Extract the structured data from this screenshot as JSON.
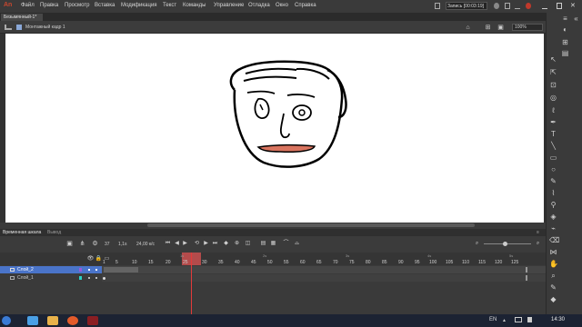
{
  "app": {
    "logo": "An"
  },
  "menu": [
    "Файл",
    "Правка",
    "Просмотр",
    "Вставка",
    "Модификация",
    "Текст",
    "Команды",
    "Управление",
    "Отладка",
    "Окно",
    "Справка"
  ],
  "recording": "Запись [00:03:19]",
  "doc_tab": "Безымянный-1*",
  "scene": {
    "label": "Монтажный кадр 1",
    "zoom": "100%"
  },
  "timeline": {
    "tabs": [
      "Временная шкала",
      "Вывод"
    ],
    "current_frame": "37",
    "fps": "24,00 к/с",
    "ruler_ticks": [
      "1",
      "5",
      "10",
      "15",
      "20",
      "25",
      "30",
      "35",
      "40",
      "45",
      "50",
      "55",
      "60",
      "65",
      "70",
      "75",
      "80",
      "85",
      "90",
      "95",
      "100",
      "105",
      "110",
      "115",
      "120",
      "125"
    ],
    "second_labels": [
      "1s",
      "2s",
      "3s",
      "4s",
      "5s"
    ],
    "layers": [
      {
        "name": "Слой_2",
        "selected": true,
        "color": "#9b59d6"
      },
      {
        "name": "Слой_1",
        "selected": false,
        "color": "#2ad1c4"
      }
    ]
  },
  "taskbar": {
    "lang": "EN",
    "time": "14:30"
  },
  "colors": {
    "accent": "#c8472f",
    "selected_layer": "#4a74c9",
    "playhead": "#e33a3a"
  }
}
